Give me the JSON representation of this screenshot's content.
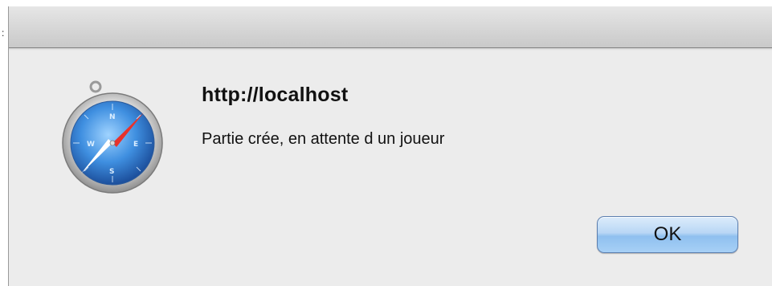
{
  "dialog": {
    "title": "http://localhost",
    "message": "Partie crée, en attente d un joueur",
    "ok_label": "OK"
  },
  "icon": {
    "name": "safari-compass-icon"
  }
}
